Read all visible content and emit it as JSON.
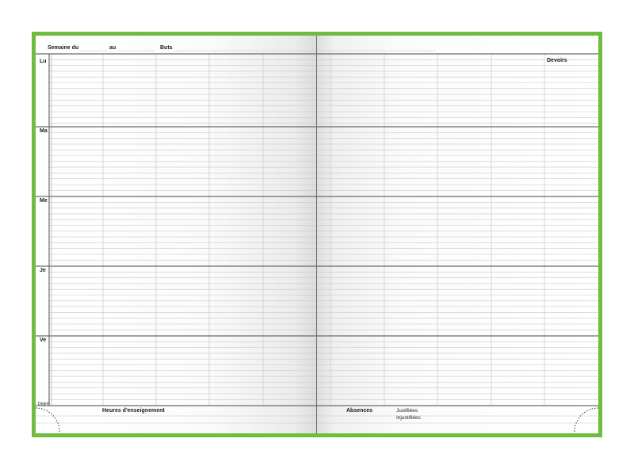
{
  "header": {
    "week_label": "Semaine du",
    "to_label": "au",
    "goals_label": "Buts",
    "homework_label": "Devoirs"
  },
  "days": [
    "Lu",
    "Ma",
    "Me",
    "Je",
    "Ve"
  ],
  "degree_label": "Degré",
  "footer": {
    "teaching_hours_label": "Heures d'enseignement",
    "absences_label": "Absences",
    "justified_label": "Justifiées",
    "unjustified_label": "Injustifiées"
  },
  "colors": {
    "cover": "#6fbd3f",
    "rule_line": "#c8c8c8",
    "heavy_line": "#6a6a6a"
  }
}
